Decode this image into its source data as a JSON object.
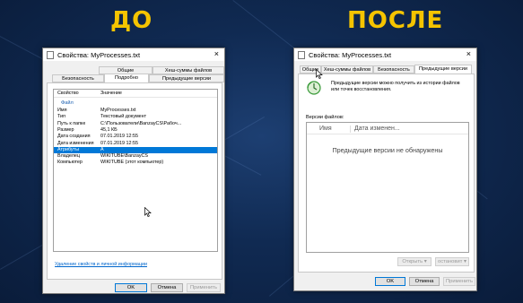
{
  "headings": {
    "before": "ДО",
    "after": "ПОСЛЕ"
  },
  "left_window": {
    "title": "Свойства: MyProcesses.txt",
    "close_glyph": "×",
    "tabs_row1": [
      "Общие",
      "Хеш-суммы файлов"
    ],
    "tabs_row2": [
      "Безопасность",
      "Подробно",
      "Предыдущие версии"
    ],
    "columns": {
      "property": "Свойство",
      "value": "Значение"
    },
    "group": "Файл",
    "rows": [
      {
        "prop": "Имя",
        "val": "MyProcesses.txt"
      },
      {
        "prop": "Тип",
        "val": "Текстовый документ"
      },
      {
        "prop": "Путь к папке",
        "val": "C:\\Пользователи\\BanzayCS\\Рабоч..."
      },
      {
        "prop": "Размер",
        "val": "45,1 КБ"
      },
      {
        "prop": "Дата создания",
        "val": "07.01.2019 12:55"
      },
      {
        "prop": "Дата изменения",
        "val": "07.01.2019 12:55"
      },
      {
        "prop": "Атрибуты",
        "val": "A"
      },
      {
        "prop": "Владелец",
        "val": "WIKITUBE\\BanzayCS"
      },
      {
        "prop": "Компьютер",
        "val": "WIKITUBE (этот компьютер)"
      }
    ],
    "remove_link": "Удаление свойств и личной информации",
    "buttons": {
      "ok": "OK",
      "cancel": "Отмена",
      "apply": "Применить"
    }
  },
  "right_window": {
    "title": "Свойства: MyProcesses.txt",
    "close_glyph": "×",
    "tabs": [
      "Общие",
      "Хеш-суммы файлов",
      "Безопасность",
      "Предыдущие версии"
    ],
    "info_text": "Предыдущие версии можно получить из истории файлов или точек восстановления.",
    "versions_label": "Версии файлов:",
    "columns": {
      "name": "Имя",
      "date": "Дата изменен..."
    },
    "empty_text": "Предыдущие версии не обнаружены",
    "buttons": {
      "open": "Открыть",
      "restore": "остановит",
      "ok": "OK",
      "cancel": "Отмена",
      "apply": "Применить"
    },
    "dropdown_glyph": "▾"
  },
  "colors": {
    "heading": "#f5c400",
    "selection": "#0078d7",
    "underline": "#e02020"
  }
}
